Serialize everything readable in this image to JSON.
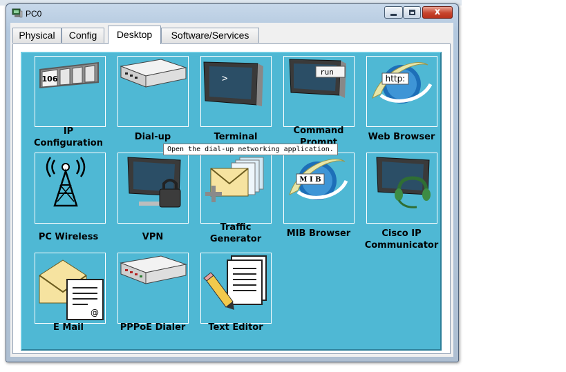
{
  "window": {
    "title": "PC0"
  },
  "window_controls": {
    "close_glyph": "x"
  },
  "tabs": [
    {
      "label": "Physical",
      "active": false
    },
    {
      "label": "Config",
      "active": false
    },
    {
      "label": "Desktop",
      "active": true
    },
    {
      "label": "Software/Services",
      "active": false
    }
  ],
  "desktop": {
    "background_color": "#4fb8d4",
    "apps": [
      {
        "label": "IP\nConfiguration",
        "icon": "ip-configuration-icon"
      },
      {
        "label": "Dial-up",
        "icon": "dial-up-icon"
      },
      {
        "label": "Terminal",
        "icon": "terminal-icon"
      },
      {
        "label": "Command\nPrompt",
        "icon": "command-prompt-icon"
      },
      {
        "label": "Web Browser",
        "icon": "web-browser-icon"
      },
      {
        "label": "PC Wireless",
        "icon": "pc-wireless-icon"
      },
      {
        "label": "VPN",
        "icon": "vpn-icon"
      },
      {
        "label": "Traffic\nGenerator",
        "icon": "traffic-generator-icon"
      },
      {
        "label": "MIB Browser",
        "icon": "mib-browser-icon"
      },
      {
        "label": "Cisco IP\nCommunicator",
        "icon": "cisco-ip-communicator-icon"
      },
      {
        "label": "E Mail",
        "icon": "email-icon"
      },
      {
        "label": "PPPoE Dialer",
        "icon": "pppoe-dialer-icon"
      },
      {
        "label": "Text Editor",
        "icon": "text-editor-icon"
      }
    ],
    "icon_text": {
      "ip_number": "106",
      "terminal_prompt": ">",
      "cmd_run": "run",
      "web_http": "http:",
      "mib_text": "M I B",
      "email_at": "@"
    }
  },
  "tooltip": {
    "text": "Open the dial-up networking application."
  }
}
